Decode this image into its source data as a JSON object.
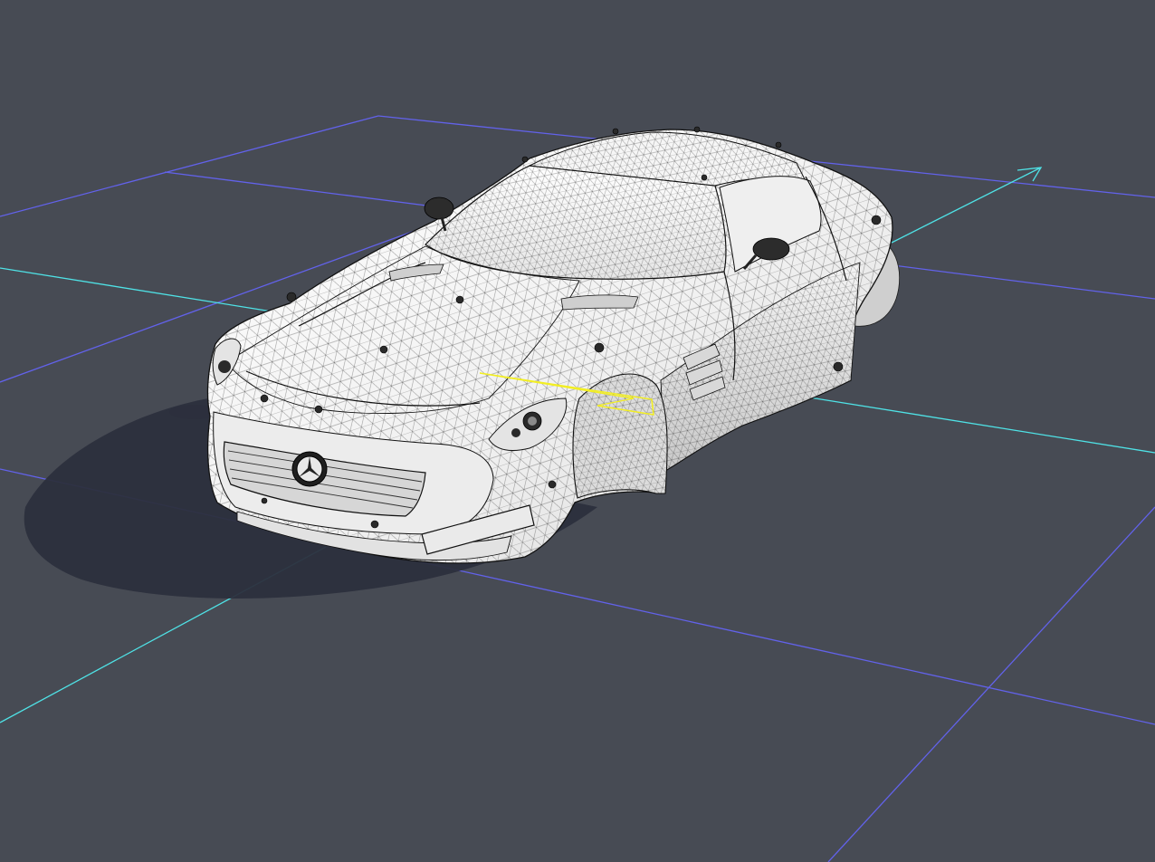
{
  "viewport": {
    "background": "#474b54",
    "grid_color": "#6262ea",
    "axis_color": "#4fe2e6",
    "selection_color": "#f2ee22",
    "shadow_color": "#2c2f3d",
    "body_color": "#f2f2f2",
    "wire_color": "#1c1c1c"
  },
  "scene": {
    "object": "car-body-mesh",
    "render_mode": "shaded-wireframe",
    "axis_icon": "axis-arrow-icon",
    "emblem_icon": "star-emblem-icon"
  }
}
